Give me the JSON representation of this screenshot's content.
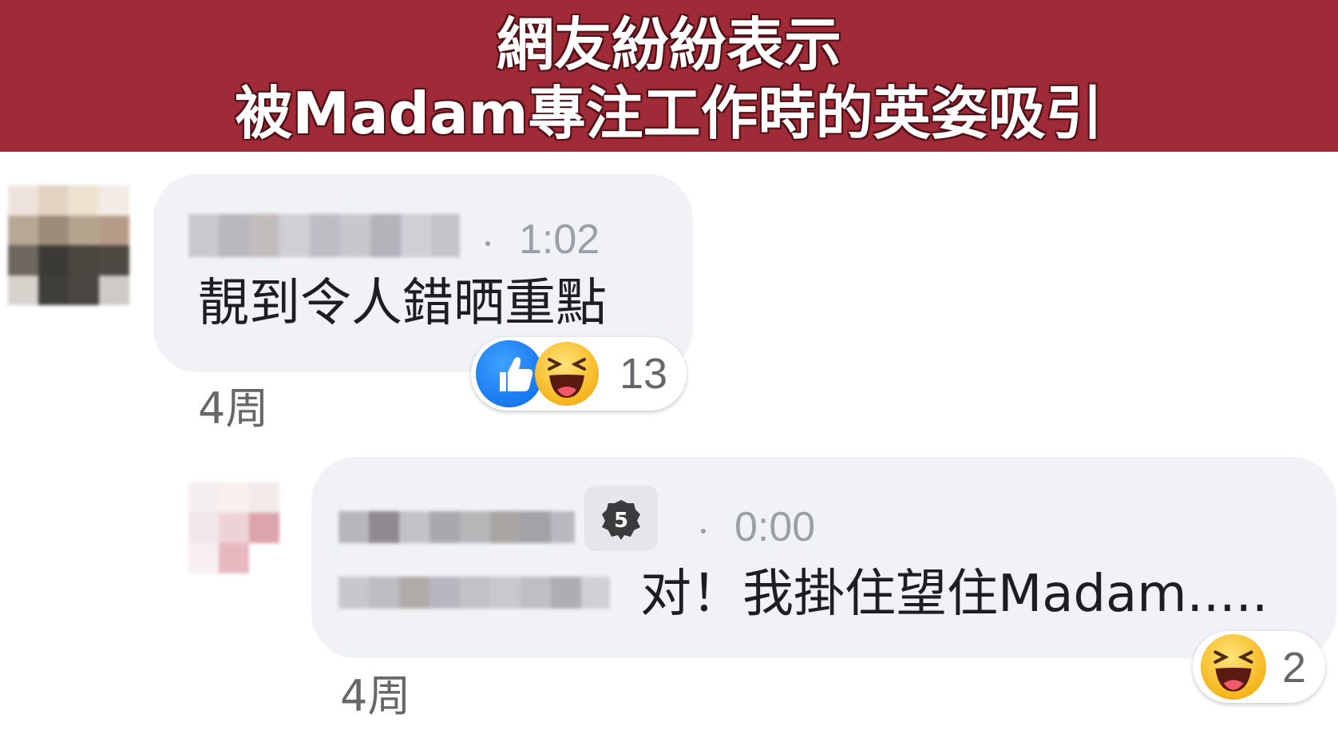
{
  "banner": {
    "line1": "網友紛紛表示",
    "line2": "被Madam專注工作時的英姿吸引"
  },
  "comments": [
    {
      "author": "[blurred]",
      "time": "1:02",
      "text": "靚到令人錯晒重點",
      "reactions": [
        "like-icon",
        "haha-icon"
      ],
      "reaction_count": "13",
      "age": "4周"
    },
    {
      "author": "[blurred]",
      "badge_level": "5",
      "time": "0:00",
      "text": "对！我掛住望住Madam.....",
      "reactions": [
        "haha-icon"
      ],
      "reaction_count": "2",
      "age": "4周"
    }
  ],
  "colors": {
    "banner_bg": "#9e2b37",
    "bubble_bg": "#f0f2f5",
    "like_blue": "#0866e8",
    "haha_yellow": "#f6b51d"
  }
}
